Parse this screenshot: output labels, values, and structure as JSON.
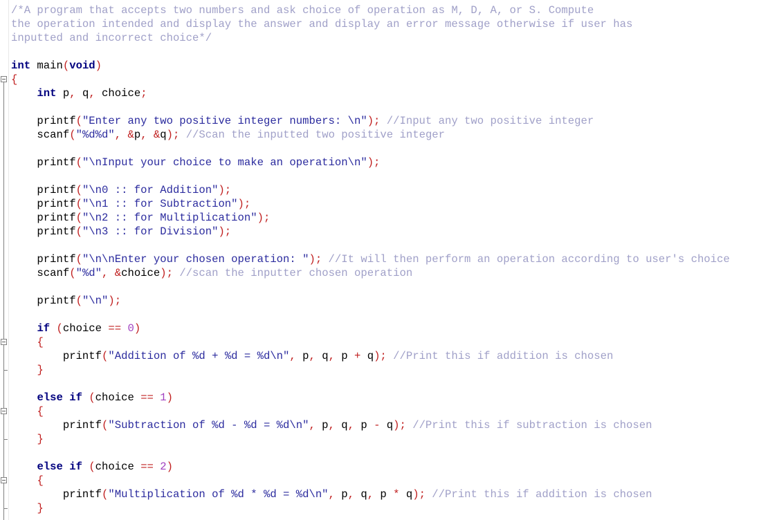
{
  "editor": {
    "language": "C",
    "lines": [
      {
        "tokens": [
          {
            "t": "cm",
            "v": "/*A program that accepts two numbers and ask choice of operation as M, D, A, or S. Compute"
          }
        ]
      },
      {
        "tokens": [
          {
            "t": "cm",
            "v": "the operation intended and display the answer and display an error message otherwise if user has"
          }
        ]
      },
      {
        "tokens": [
          {
            "t": "cm",
            "v": "inputted and incorrect choice*/"
          }
        ]
      },
      {
        "tokens": []
      },
      {
        "tokens": [
          {
            "t": "kw",
            "v": "int"
          },
          {
            "t": "id",
            "v": " main"
          },
          {
            "t": "op",
            "v": "("
          },
          {
            "t": "kw",
            "v": "void"
          },
          {
            "t": "op",
            "v": ")"
          }
        ]
      },
      {
        "tokens": [
          {
            "t": "op",
            "v": "{"
          }
        ]
      },
      {
        "tokens": [
          {
            "t": "id",
            "v": "    "
          },
          {
            "t": "kw",
            "v": "int"
          },
          {
            "t": "id",
            "v": " p"
          },
          {
            "t": "op",
            "v": ","
          },
          {
            "t": "id",
            "v": " q"
          },
          {
            "t": "op",
            "v": ","
          },
          {
            "t": "id",
            "v": " choice"
          },
          {
            "t": "op",
            "v": ";"
          }
        ]
      },
      {
        "tokens": []
      },
      {
        "tokens": [
          {
            "t": "id",
            "v": "    printf"
          },
          {
            "t": "op",
            "v": "("
          },
          {
            "t": "st",
            "v": "\"Enter any two positive integer numbers: \\n\""
          },
          {
            "t": "op",
            "v": ");"
          },
          {
            "t": "cm",
            "v": " //Input any two positive integer"
          }
        ]
      },
      {
        "tokens": [
          {
            "t": "id",
            "v": "    scanf"
          },
          {
            "t": "op",
            "v": "("
          },
          {
            "t": "st",
            "v": "\"%d%d\""
          },
          {
            "t": "op",
            "v": ","
          },
          {
            "t": "id",
            "v": " "
          },
          {
            "t": "op",
            "v": "&"
          },
          {
            "t": "id",
            "v": "p"
          },
          {
            "t": "op",
            "v": ","
          },
          {
            "t": "id",
            "v": " "
          },
          {
            "t": "op",
            "v": "&"
          },
          {
            "t": "id",
            "v": "q"
          },
          {
            "t": "op",
            "v": ");"
          },
          {
            "t": "cm",
            "v": " //Scan the inputted two positive integer"
          }
        ]
      },
      {
        "tokens": []
      },
      {
        "tokens": [
          {
            "t": "id",
            "v": "    printf"
          },
          {
            "t": "op",
            "v": "("
          },
          {
            "t": "st",
            "v": "\"\\nInput your choice to make an operation\\n\""
          },
          {
            "t": "op",
            "v": ");"
          }
        ]
      },
      {
        "tokens": []
      },
      {
        "tokens": [
          {
            "t": "id",
            "v": "    printf"
          },
          {
            "t": "op",
            "v": "("
          },
          {
            "t": "st",
            "v": "\"\\n0 :: for Addition\""
          },
          {
            "t": "op",
            "v": ");"
          }
        ]
      },
      {
        "tokens": [
          {
            "t": "id",
            "v": "    printf"
          },
          {
            "t": "op",
            "v": "("
          },
          {
            "t": "st",
            "v": "\"\\n1 :: for Subtraction\""
          },
          {
            "t": "op",
            "v": ");"
          }
        ]
      },
      {
        "tokens": [
          {
            "t": "id",
            "v": "    printf"
          },
          {
            "t": "op",
            "v": "("
          },
          {
            "t": "st",
            "v": "\"\\n2 :: for Multiplication\""
          },
          {
            "t": "op",
            "v": ");"
          }
        ]
      },
      {
        "tokens": [
          {
            "t": "id",
            "v": "    printf"
          },
          {
            "t": "op",
            "v": "("
          },
          {
            "t": "st",
            "v": "\"\\n3 :: for Division\""
          },
          {
            "t": "op",
            "v": ");"
          }
        ]
      },
      {
        "tokens": []
      },
      {
        "tokens": [
          {
            "t": "id",
            "v": "    printf"
          },
          {
            "t": "op",
            "v": "("
          },
          {
            "t": "st",
            "v": "\"\\n\\nEnter your chosen operation: \""
          },
          {
            "t": "op",
            "v": ");"
          },
          {
            "t": "cm",
            "v": " //It will then perform an operation according to user's choice"
          }
        ]
      },
      {
        "tokens": [
          {
            "t": "id",
            "v": "    scanf"
          },
          {
            "t": "op",
            "v": "("
          },
          {
            "t": "st",
            "v": "\"%d\""
          },
          {
            "t": "op",
            "v": ","
          },
          {
            "t": "id",
            "v": " "
          },
          {
            "t": "op",
            "v": "&"
          },
          {
            "t": "id",
            "v": "choice"
          },
          {
            "t": "op",
            "v": ");"
          },
          {
            "t": "cm",
            "v": " //scan the inputter chosen operation"
          }
        ]
      },
      {
        "tokens": []
      },
      {
        "tokens": [
          {
            "t": "id",
            "v": "    printf"
          },
          {
            "t": "op",
            "v": "("
          },
          {
            "t": "st",
            "v": "\"\\n\""
          },
          {
            "t": "op",
            "v": ");"
          }
        ]
      },
      {
        "tokens": []
      },
      {
        "tokens": [
          {
            "t": "id",
            "v": "    "
          },
          {
            "t": "kw",
            "v": "if"
          },
          {
            "t": "id",
            "v": " "
          },
          {
            "t": "op",
            "v": "("
          },
          {
            "t": "id",
            "v": "choice "
          },
          {
            "t": "op",
            "v": "=="
          },
          {
            "t": "id",
            "v": " "
          },
          {
            "t": "nu",
            "v": "0"
          },
          {
            "t": "op",
            "v": ")"
          }
        ]
      },
      {
        "tokens": [
          {
            "t": "id",
            "v": "    "
          },
          {
            "t": "op",
            "v": "{"
          }
        ]
      },
      {
        "tokens": [
          {
            "t": "id",
            "v": "        printf"
          },
          {
            "t": "op",
            "v": "("
          },
          {
            "t": "st",
            "v": "\"Addition of %d + %d = %d\\n\""
          },
          {
            "t": "op",
            "v": ","
          },
          {
            "t": "id",
            "v": " p"
          },
          {
            "t": "op",
            "v": ","
          },
          {
            "t": "id",
            "v": " q"
          },
          {
            "t": "op",
            "v": ","
          },
          {
            "t": "id",
            "v": " p "
          },
          {
            "t": "op",
            "v": "+"
          },
          {
            "t": "id",
            "v": " q"
          },
          {
            "t": "op",
            "v": ");"
          },
          {
            "t": "cm",
            "v": " //Print this if addition is chosen"
          }
        ]
      },
      {
        "tokens": [
          {
            "t": "id",
            "v": "    "
          },
          {
            "t": "op",
            "v": "}"
          }
        ]
      },
      {
        "tokens": []
      },
      {
        "tokens": [
          {
            "t": "id",
            "v": "    "
          },
          {
            "t": "kw",
            "v": "else"
          },
          {
            "t": "id",
            "v": " "
          },
          {
            "t": "kw",
            "v": "if"
          },
          {
            "t": "id",
            "v": " "
          },
          {
            "t": "op",
            "v": "("
          },
          {
            "t": "id",
            "v": "choice "
          },
          {
            "t": "op",
            "v": "=="
          },
          {
            "t": "id",
            "v": " "
          },
          {
            "t": "nu",
            "v": "1"
          },
          {
            "t": "op",
            "v": ")"
          }
        ]
      },
      {
        "tokens": [
          {
            "t": "id",
            "v": "    "
          },
          {
            "t": "op",
            "v": "{"
          }
        ]
      },
      {
        "tokens": [
          {
            "t": "id",
            "v": "        printf"
          },
          {
            "t": "op",
            "v": "("
          },
          {
            "t": "st",
            "v": "\"Subtraction of %d - %d = %d\\n\""
          },
          {
            "t": "op",
            "v": ","
          },
          {
            "t": "id",
            "v": " p"
          },
          {
            "t": "op",
            "v": ","
          },
          {
            "t": "id",
            "v": " q"
          },
          {
            "t": "op",
            "v": ","
          },
          {
            "t": "id",
            "v": " p "
          },
          {
            "t": "op",
            "v": "-"
          },
          {
            "t": "id",
            "v": " q"
          },
          {
            "t": "op",
            "v": ");"
          },
          {
            "t": "cm",
            "v": " //Print this if subtraction is chosen"
          }
        ]
      },
      {
        "tokens": [
          {
            "t": "id",
            "v": "    "
          },
          {
            "t": "op",
            "v": "}"
          }
        ]
      },
      {
        "tokens": []
      },
      {
        "tokens": [
          {
            "t": "id",
            "v": "    "
          },
          {
            "t": "kw",
            "v": "else"
          },
          {
            "t": "id",
            "v": " "
          },
          {
            "t": "kw",
            "v": "if"
          },
          {
            "t": "id",
            "v": " "
          },
          {
            "t": "op",
            "v": "("
          },
          {
            "t": "id",
            "v": "choice "
          },
          {
            "t": "op",
            "v": "=="
          },
          {
            "t": "id",
            "v": " "
          },
          {
            "t": "nu",
            "v": "2"
          },
          {
            "t": "op",
            "v": ")"
          }
        ]
      },
      {
        "tokens": [
          {
            "t": "id",
            "v": "    "
          },
          {
            "t": "op",
            "v": "{"
          }
        ]
      },
      {
        "tokens": [
          {
            "t": "id",
            "v": "        printf"
          },
          {
            "t": "op",
            "v": "("
          },
          {
            "t": "st",
            "v": "\"Multiplication of %d * %d = %d\\n\""
          },
          {
            "t": "op",
            "v": ","
          },
          {
            "t": "id",
            "v": " p"
          },
          {
            "t": "op",
            "v": ","
          },
          {
            "t": "id",
            "v": " q"
          },
          {
            "t": "op",
            "v": ","
          },
          {
            "t": "id",
            "v": " p "
          },
          {
            "t": "op",
            "v": "*"
          },
          {
            "t": "id",
            "v": " q"
          },
          {
            "t": "op",
            "v": ");"
          },
          {
            "t": "cm",
            "v": " //Print this if addition is chosen"
          }
        ]
      },
      {
        "tokens": [
          {
            "t": "id",
            "v": "    "
          },
          {
            "t": "op",
            "v": "}"
          }
        ]
      }
    ],
    "fold_markers": [
      {
        "line": 6,
        "type": "box"
      },
      {
        "line": 25,
        "type": "box"
      },
      {
        "line": 27,
        "type": "tick"
      },
      {
        "line": 30,
        "type": "box"
      },
      {
        "line": 32,
        "type": "tick"
      },
      {
        "line": 35,
        "type": "box"
      },
      {
        "line": 37,
        "type": "tick"
      }
    ],
    "colors": {
      "comment": "#a0a0c8",
      "keyword": "#00007f",
      "string": "#2b2b9e",
      "operator": "#c02020",
      "number": "#a040c0",
      "identifier": "#000000"
    }
  }
}
